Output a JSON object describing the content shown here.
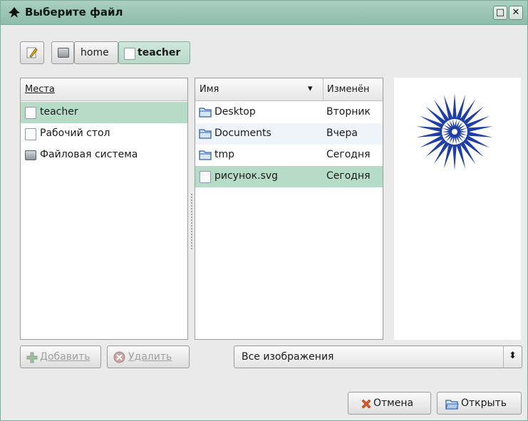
{
  "window": {
    "title": "Выберите файл",
    "maximize_glyph": "□",
    "close_glyph": "✕"
  },
  "pathbar": {
    "edit_icon": "pencil-icon",
    "segments": [
      "home",
      "teacher"
    ],
    "active_segment": "teacher"
  },
  "places": {
    "header": "Места",
    "items": [
      {
        "label": "teacher",
        "icon": "home-folder-icon",
        "selected": true
      },
      {
        "label": "Рабочий стол",
        "icon": "desktop-icon",
        "selected": false
      },
      {
        "label": "Файловая система",
        "icon": "drive-icon",
        "selected": false
      }
    ]
  },
  "files": {
    "name_header": "Имя",
    "modified_header": "Изменён",
    "sort_indicator": "▾",
    "rows": [
      {
        "name": "Desktop",
        "modified": "Вторник",
        "icon": "folder-icon",
        "state": "normal"
      },
      {
        "name": "Documents",
        "modified": "Вчера",
        "icon": "folder-icon",
        "state": "alt"
      },
      {
        "name": "tmp",
        "modified": "Сегодня",
        "icon": "folder-icon",
        "state": "normal"
      },
      {
        "name": "рисунок.svg",
        "modified": "Сегодня",
        "icon": "file-icon",
        "state": "selected"
      }
    ]
  },
  "preview": {
    "icon": "star-preview-image"
  },
  "buttons": {
    "add_label": "Добавить",
    "remove_label": "Удалить",
    "cancel_label": "Отмена",
    "open_label": "Открыть"
  },
  "filter": {
    "selected": "Все изображения",
    "arrow_glyph": "⬍"
  },
  "colors": {
    "titlebar": "#9fc7b7",
    "selection": "#b6dcc8",
    "alt_row": "#eef4fa",
    "star_blue": "#1f3fa6"
  }
}
